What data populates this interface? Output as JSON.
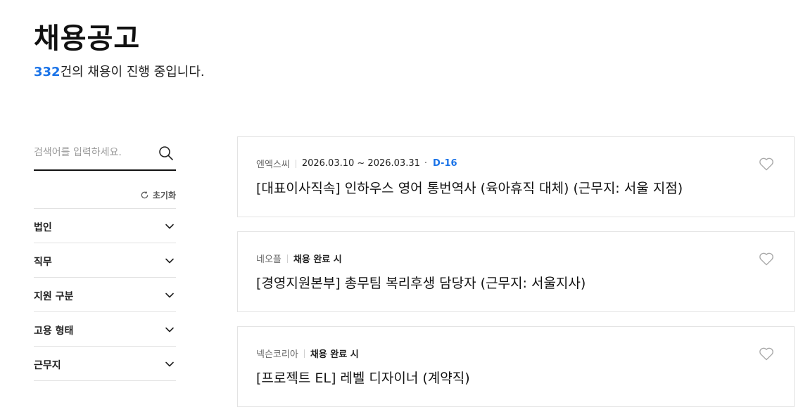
{
  "header": {
    "title": "채용공고",
    "count": "332",
    "count_suffix": "건의 채용이 진행 중입니다."
  },
  "sidebar": {
    "search_placeholder": "검색어를 입력하세요.",
    "reset_label": "초기화",
    "filters": [
      {
        "label": "법인"
      },
      {
        "label": "직무"
      },
      {
        "label": "지원 구분"
      },
      {
        "label": "고용 형태"
      },
      {
        "label": "근무지"
      }
    ]
  },
  "jobs": [
    {
      "company": "엔엑스씨",
      "period": "2026.03.10 ~ 2026.03.31",
      "dday": "D-16",
      "title": "[대표이사직속] 인하우스 영어 통번역사 (육아휴직 대체) (근무지: 서울 지점)"
    },
    {
      "company": "네오플",
      "period": "채용 완료 시",
      "dday": "",
      "title": "[경영지원본부] 총무팀 복리후생 담당자 (근무지: 서울지사)"
    },
    {
      "company": "넥슨코리아",
      "period": "채용 완료 시",
      "dday": "",
      "title": "[프로젝트 EL] 레벨 디자이너 (계약직)"
    }
  ],
  "colors": {
    "accent": "#1a73e8",
    "border": "#e3e3e3",
    "text": "#111111"
  },
  "icons": {
    "search": "search-icon",
    "reset": "refresh-icon",
    "chevron": "chevron-down-icon",
    "favorite": "heart-icon"
  }
}
